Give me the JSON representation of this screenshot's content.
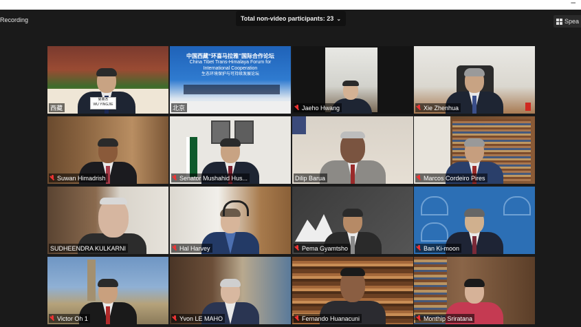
{
  "window": {
    "minimize_glyph": "–"
  },
  "header": {
    "recording_label": "Recording",
    "participants_label": "Total non-video participants: 23",
    "speaker_view_label": "Spea"
  },
  "banner": {
    "line1": "中国西藏“环喜马拉雅”国际合作论坛",
    "line2": "China Tibet Trans-Himalaya Forum for International Cooperation",
    "line3": "生态环境保护与可持续发展论坛"
  },
  "nameplate": {
    "line1": "吴英杰",
    "line2": "WU YINGJIE"
  },
  "tiles": [
    {
      "name": "西藏",
      "active": true
    },
    {
      "name": "北京"
    },
    {
      "name": "Jaeho Hwang"
    },
    {
      "name": "Xie Zhenhua"
    },
    {
      "name": "Suwan Himadrish"
    },
    {
      "name": "Senator Mushahid Hus..."
    },
    {
      "name": "Dilip Barua"
    },
    {
      "name": "Marcos Cordeiro Pires"
    },
    {
      "name": "SUDHEENDRA KULKARNI"
    },
    {
      "name": "Hal Harvey"
    },
    {
      "name": "Pema Gyamtsho"
    },
    {
      "name": "Ban Ki-moon"
    },
    {
      "name": "Victor Oh 1"
    },
    {
      "name": "Yvon LE MAHO"
    },
    {
      "name": "Fernando Huanacuni"
    },
    {
      "name": "Monthip Sriratana"
    }
  ]
}
